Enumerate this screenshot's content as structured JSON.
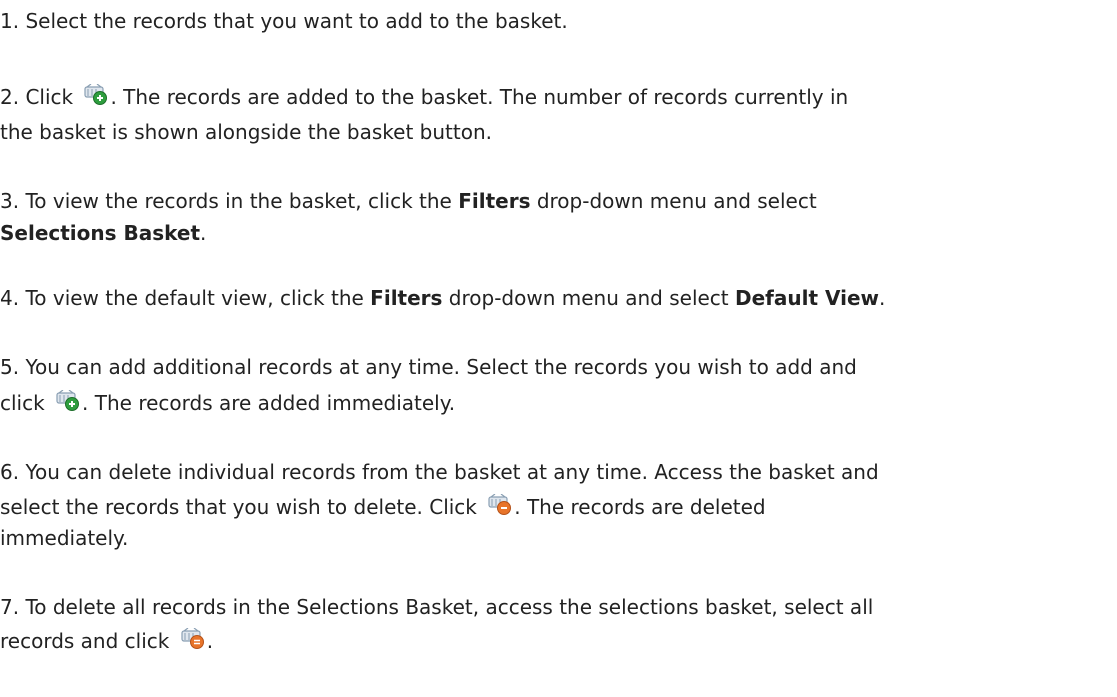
{
  "steps": [
    {
      "l1": "1. Select the records that you want to add to the basket."
    },
    {
      "l1_a": "2. Click ",
      "l1_icon": "basket-add-icon",
      "l1_b": ". The records are added to the basket. The number of records currently in",
      "l2": "the basket is shown alongside the basket button."
    },
    {
      "l1_a": "3. To view the records in the basket, click the ",
      "l1_b1": "Filters",
      "l1_b": " drop-down menu and select",
      "l2_b": "Selections Basket",
      "l2_end": "."
    },
    {
      "l1_a": "4. To view the default view, click the ",
      "l1_b1": "Filters",
      "l1_mid": " drop-down menu and select ",
      "l1_b2": "Default View",
      "l1_end": "."
    },
    {
      "l1": "5. You can add additional records at any time. Select the records you wish to add and",
      "l2_a": "click ",
      "l2_icon": "basket-add-icon",
      "l2_b": ". The records are added immediately."
    },
    {
      "l1": "6. You can delete individual records from the basket at any time. Access the basket and",
      "l2_a": "select the records that you wish to delete. Click ",
      "l2_icon": "basket-remove-icon",
      "l2_b": ". The records are deleted",
      "l3": "immediately."
    },
    {
      "l1": "7. To delete all records in the Selections Basket, access the selections basket, select all",
      "l2_a": "records and click ",
      "l2_icon": "basket-remove-all-icon",
      "l2_end": "."
    }
  ],
  "colors": {
    "text": "#222222",
    "basket": "#8a9fb3",
    "add_badge": "#2e9e3e",
    "remove_badge": "#e8742a"
  }
}
